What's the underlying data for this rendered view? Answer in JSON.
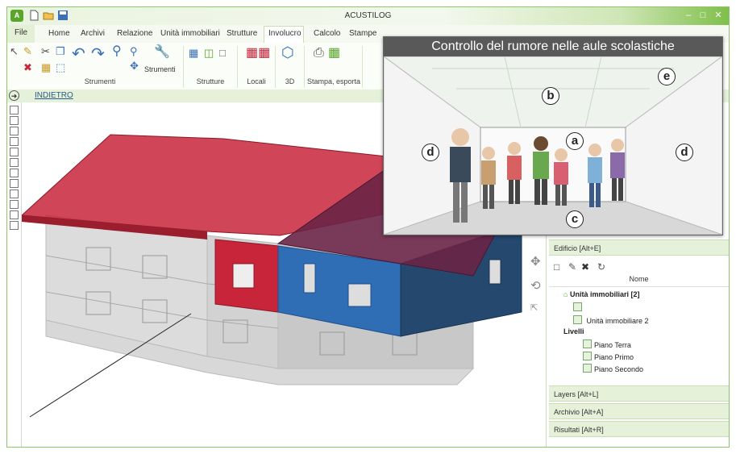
{
  "window": {
    "title": "ACUSTILOG",
    "logo_text": "A"
  },
  "tabs": [
    "File",
    "Home",
    "Archivi",
    "Relazione",
    "Unità immobiliari",
    "Strutture",
    "Involucro",
    "Calcolo",
    "Stampe"
  ],
  "active_tab": "Involucro",
  "ribbon_groups": [
    "Strumenti",
    "Strutture",
    "Locali",
    "3D",
    "Stampa, esporta"
  ],
  "ribbon_button": "Strumenti",
  "nav": {
    "back_label": "INDIETRO"
  },
  "overlay": {
    "title": "Controllo del rumore nelle aule scolastiche",
    "labels": {
      "a": "a",
      "b": "b",
      "c": "c",
      "d_left": "d",
      "d_right": "d",
      "e": "e"
    }
  },
  "right_panel": {
    "edificio_header": "Edificio [Alt+E]",
    "column_name": "Nome",
    "tree": {
      "units_label": "Unità immobiliari [2]",
      "unit1_label": "",
      "unit2_label": "Unità immobiliare 2",
      "levels_label": "Livelli",
      "levels": [
        "Piano Terra",
        "Piano Primo",
        "Piano Secondo"
      ]
    },
    "bottom_headers": [
      "Layers [Alt+L]",
      "Archivio [Alt+A]",
      "Risultati [Alt+R]"
    ]
  },
  "colors": {
    "accent": "#8cc56a",
    "roof_red": "#c8253a",
    "wall_blue": "#2f6db5"
  }
}
